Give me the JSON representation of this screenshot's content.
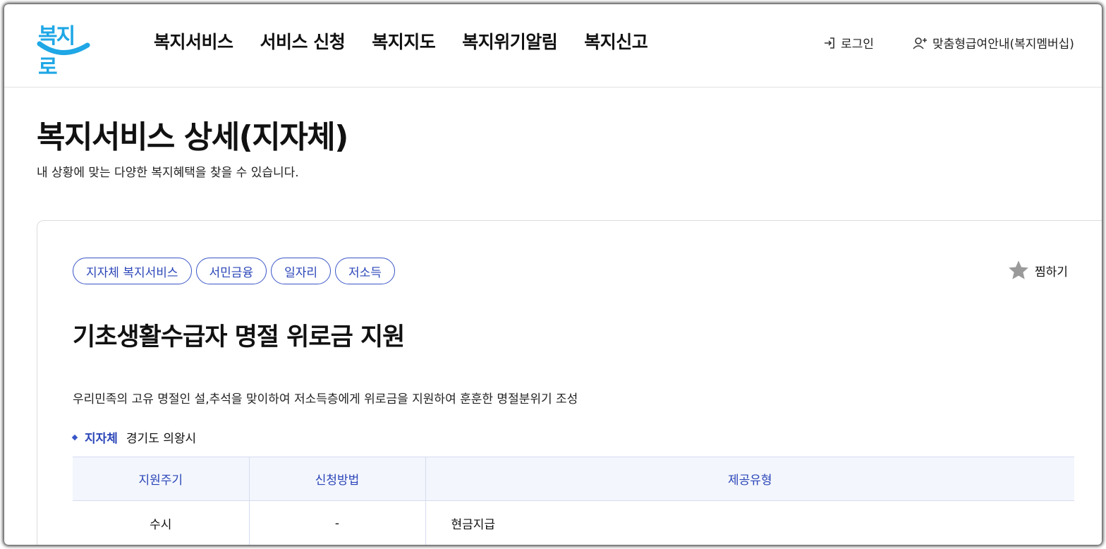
{
  "header": {
    "logo_text": "복지로",
    "logo_color": "#1fa7e6",
    "nav": [
      "복지서비스",
      "서비스 신청",
      "복지지도",
      "복지위기알림",
      "복지신고"
    ],
    "login_label": "로그인",
    "member_label": "맞춤형급여안내(복지멤버십)"
  },
  "page": {
    "title": "복지서비스 상세(지자체)",
    "description": "내 상황에 맞는 다양한 복지혜택을 찾을 수 있습니다."
  },
  "service": {
    "tags": [
      "지자체 복지서비스",
      "서민금융",
      "일자리",
      "저소득"
    ],
    "favorite_label": "찜하기",
    "title": "기초생활수급자 명절 위로금 지원",
    "description": "우리민족의 고유 명절인 설,추석을 맞이하여 저소득층에게 위로금을 지원하여 훈훈한 명절분위기 조성",
    "region_label": "지자체",
    "region_value": "경기도 의왕시",
    "table": {
      "headers": [
        "지원주기",
        "신청방법",
        "제공유형"
      ],
      "row": [
        "수시",
        "-",
        "현금지급"
      ]
    }
  },
  "colors": {
    "accent": "#2b46b8",
    "table_header_bg": "#f3f6fd"
  }
}
